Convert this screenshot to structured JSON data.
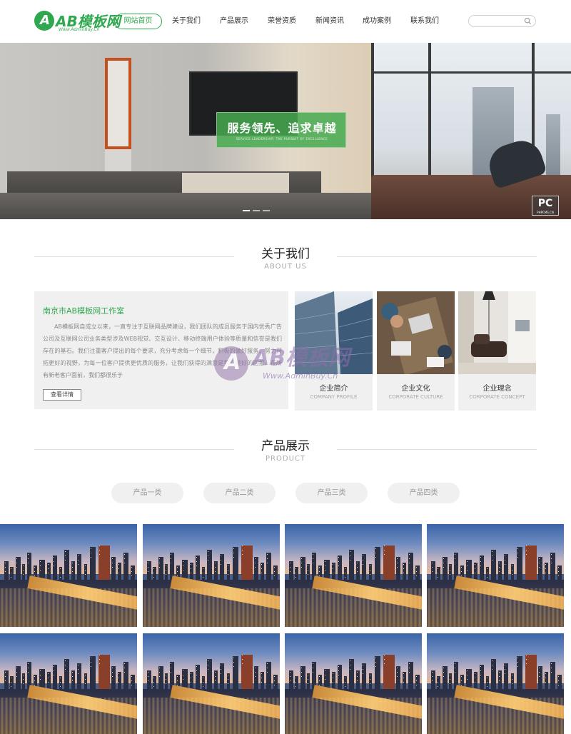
{
  "header": {
    "logo_text": "AB模板网",
    "logo_letter": "A",
    "logo_sub": "Www.AdminBuy.Cn",
    "search_placeholder": "",
    "nav": [
      {
        "label": "网站首页",
        "active": true
      },
      {
        "label": "关于我们",
        "active": false
      },
      {
        "label": "产品展示",
        "active": false
      },
      {
        "label": "荣誉资质",
        "active": false
      },
      {
        "label": "新闻资讯",
        "active": false
      },
      {
        "label": "成功案例",
        "active": false
      },
      {
        "label": "联系我们",
        "active": false
      }
    ]
  },
  "banner": {
    "slogan": "服务领先、追求卓越",
    "slogan_sub": "SERVICE LEADERSHIP, THE PURSUIT OF EXCELLENCE",
    "badge": "PC",
    "badge_sub": "PHPCMS.CN"
  },
  "about": {
    "title": "关于我们",
    "subtitle": "ABOUT US",
    "company": "南京市AB模板网工作室",
    "text": "AB模板网自成立以来，一直专注于互联网品牌建设，我们团队的成员服务于国内优秀广告公司及互联网公司业务类型涉及WEB视觉、交互设计、移动终端用户体验等质量和信誉是我们存在的基石。我们注重客户提出的每个要求，充分考虑每一个细节，积极的做好服务，努力开拓更好的视野，为每一位客户提供更优质的服务，让我们获得的满意是我们最好的回报，在所有新老客户面前，我们都很乐于",
    "more_button": "查看详情",
    "cards": [
      {
        "title": "企业简介",
        "subtitle": "COMPANY PROFILE"
      },
      {
        "title": "企业文化",
        "subtitle": "CORPORATE CULTURE"
      },
      {
        "title": "企业理念",
        "subtitle": "CORPORATE CONCEPT"
      }
    ]
  },
  "watermark": {
    "letter": "A",
    "text": "AB模板网",
    "sub": "Www.AdminBuy.Cn"
  },
  "products": {
    "title": "产品展示",
    "subtitle": "PRODUCT",
    "tabs": [
      "产品一类",
      "产品二类",
      "产品三类",
      "产品四类"
    ],
    "items_count_note": ""
  },
  "colors": {
    "brand_green": "#2fa84f",
    "section_gray": "#f0f0f0"
  }
}
